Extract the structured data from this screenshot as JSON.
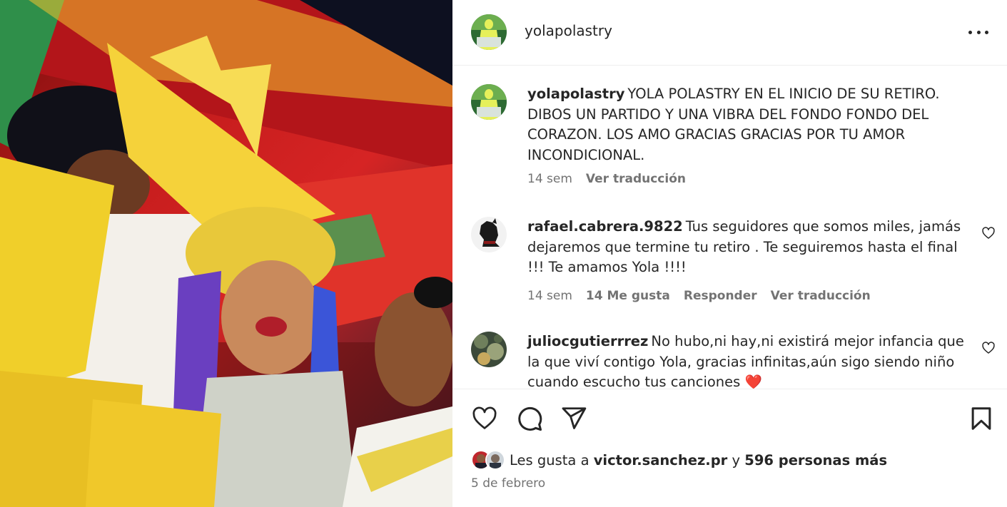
{
  "post": {
    "author": "yolapolastry",
    "more_icon": "more-horizontal-icon"
  },
  "caption": {
    "user": "yolapolastry",
    "text": "YOLA POLASTRY EN EL INICIO DE SU RETIRO. DIBOS UN PARTIDO Y UNA VIBRA DEL FONDO FONDO DEL CORAZON. LOS AMO GRACIAS GRACIAS POR TU AMOR INCONDICIONAL.",
    "time": "14 sem",
    "translate": "Ver traducción"
  },
  "comments": [
    {
      "user": "rafael.cabrera.9822",
      "text": "Tus seguidores que somos miles, jamás dejaremos que termine tu retiro . Te seguiremos hasta el final !!! Te amamos Yola !!!!",
      "time": "14 sem",
      "likes": "14 Me gusta",
      "reply": "Responder",
      "translate": "Ver traducción"
    },
    {
      "user": "juliocgutierrrez",
      "text": "No hubo,ni hay,ni existirá mejor infancia que la que viví contigo Yola, gracias infinitas,aún sigo siendo niño cuando escucho tus canciones ❤️"
    }
  ],
  "actions": {
    "like_icon": "heart-icon",
    "comment_icon": "comment-icon",
    "share_icon": "send-icon",
    "save_icon": "bookmark-icon"
  },
  "likes": {
    "prefix": "Les gusta a",
    "user": "victor.sanchez.pr",
    "joiner": "y",
    "others": "596 personas más"
  },
  "date": "5 de febrero",
  "colors": {
    "text": "#262626",
    "secondary": "#737373",
    "divider": "#efefef",
    "heart_emoji": "#e0245e"
  }
}
